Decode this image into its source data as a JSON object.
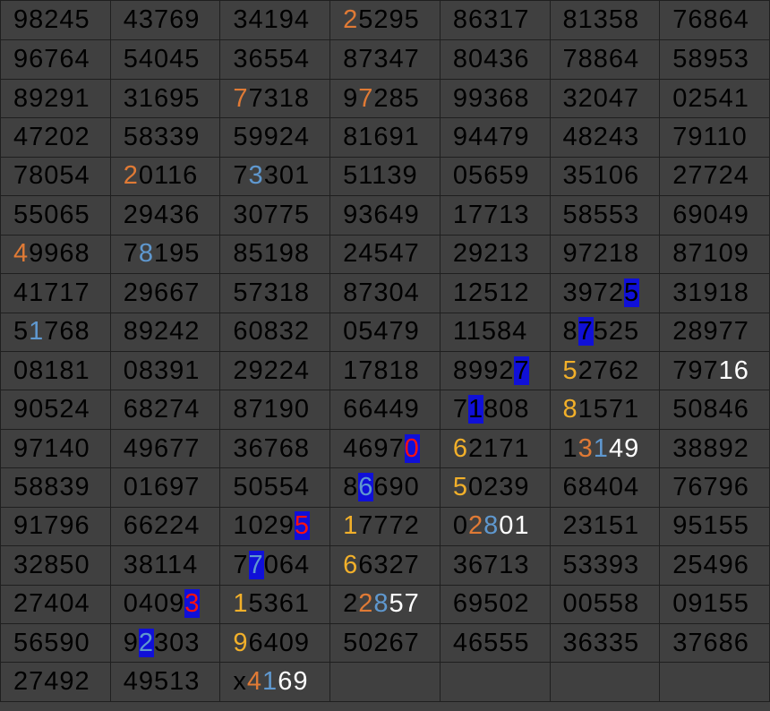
{
  "grid": {
    "rows": [
      [
        [
          [
            "2",
            "orange"
          ],
          [
            "5295",
            ""
          ]
        ],
        "98245",
        "43769",
        "34194",
        "86317",
        "81358",
        "76864"
      ],
      [
        "96764",
        "54045",
        "36554",
        "87347",
        "80436",
        "78864",
        "58953"
      ],
      [
        "89291",
        "31695",
        [
          [
            "7",
            "orange"
          ],
          [
            "7318",
            ""
          ]
        ],
        [
          [
            "9",
            ""
          ],
          [
            "7",
            "orange"
          ],
          [
            "285",
            ""
          ]
        ],
        "99368",
        "32047",
        "02541"
      ],
      [
        "47202",
        "58339",
        "59924",
        "81691",
        "94479",
        "48243",
        "79110"
      ],
      [
        "78054",
        [
          [
            "2",
            "orange"
          ],
          [
            "0116",
            ""
          ]
        ],
        [
          [
            "7",
            ""
          ],
          [
            "3",
            "lightblue"
          ],
          [
            "301",
            ""
          ]
        ],
        "51139",
        "05659",
        "35106",
        "27724"
      ],
      [
        "55065",
        "29436",
        "30775",
        "93649",
        "17713",
        "58553",
        "69049"
      ],
      [
        [
          [
            "4",
            "orange"
          ],
          [
            "9968",
            ""
          ]
        ],
        [
          [
            "7",
            ""
          ],
          [
            "8",
            "lightblue"
          ],
          [
            "195",
            ""
          ]
        ],
        "85198",
        "24547",
        "29213",
        "97218",
        "87109"
      ],
      [
        "41717",
        "29667",
        "57318",
        "87304",
        "12512",
        [
          [
            "3972",
            ""
          ],
          [
            "5",
            "bluebox"
          ]
        ],
        "31918"
      ],
      [
        [
          [
            "5",
            ""
          ],
          [
            "1",
            "lightblue"
          ],
          [
            "768",
            ""
          ]
        ],
        "89242",
        "60832",
        "05479",
        "11584",
        [
          [
            "8",
            ""
          ],
          [
            "7",
            "bluebox"
          ],
          [
            "525",
            ""
          ]
        ],
        "28977"
      ],
      [
        "08181",
        "08391",
        "29224",
        "17818",
        [
          [
            "8992",
            ""
          ],
          [
            "7",
            "bluebox"
          ]
        ],
        [
          [
            "5",
            "yellow"
          ],
          [
            "2762",
            ""
          ]
        ],
        [
          [
            "797",
            ""
          ],
          [
            "16",
            "white"
          ]
        ]
      ],
      [
        "90524",
        "68274",
        "87190",
        "66449",
        [
          [
            "7",
            ""
          ],
          [
            "1",
            "bluebox"
          ],
          [
            "808",
            ""
          ]
        ],
        [
          [
            "8",
            "yellow"
          ],
          [
            "1571",
            ""
          ]
        ],
        "50846"
      ],
      [
        "97140",
        "49677",
        "36768",
        [
          [
            "4697",
            ""
          ],
          [
            "0",
            "red"
          ]
        ],
        [
          [
            "6",
            "yellow"
          ],
          [
            "2171",
            ""
          ]
        ],
        [
          [
            "1",
            ""
          ],
          [
            "3",
            "orange"
          ],
          [
            "1",
            "lightblue"
          ],
          [
            "49",
            "white"
          ]
        ],
        "38892"
      ],
      [
        "58839",
        "01697",
        "50554",
        [
          [
            "8",
            ""
          ],
          [
            "6",
            "lightbluebox"
          ],
          [
            "690",
            ""
          ]
        ],
        [
          [
            "5",
            "yellow"
          ],
          [
            "0239",
            ""
          ]
        ],
        "68404",
        "76796"
      ],
      [
        "91796",
        "66224",
        [
          [
            "1029",
            ""
          ],
          [
            "5",
            "red"
          ]
        ],
        [
          [
            "1",
            "yellow"
          ],
          [
            "7772",
            ""
          ]
        ],
        [
          [
            "0",
            ""
          ],
          [
            "2",
            "orange"
          ],
          [
            "8",
            "lightblue"
          ],
          [
            "01",
            "white"
          ]
        ],
        "23151",
        "95155"
      ],
      [
        "32850",
        "38114",
        [
          [
            "7",
            ""
          ],
          [
            "7",
            "lightbluebox"
          ],
          [
            "064",
            ""
          ]
        ],
        [
          [
            "6",
            "yellow"
          ],
          [
            "6327",
            ""
          ]
        ],
        "36713",
        "53393",
        "25496"
      ],
      [
        "27404",
        [
          [
            "0409",
            ""
          ],
          [
            "3",
            "red"
          ]
        ],
        [
          [
            "1",
            "yellow"
          ],
          [
            "5361",
            ""
          ]
        ],
        [
          [
            "2",
            ""
          ],
          [
            "2",
            "orange"
          ],
          [
            "8",
            "lightblue"
          ],
          [
            "57",
            "white"
          ]
        ],
        "69502",
        "00558",
        "09155"
      ],
      [
        "56590",
        [
          [
            "9",
            ""
          ],
          [
            "2",
            "lightbluebox"
          ],
          [
            "303",
            ""
          ]
        ],
        [
          [
            "9",
            "yellow"
          ],
          [
            "6409",
            ""
          ]
        ],
        "50267",
        "46555",
        "36335",
        "37686"
      ],
      [
        "27492",
        "49513",
        [
          [
            "x",
            ""
          ],
          [
            "4",
            "orange"
          ],
          [
            "1",
            "lightblue"
          ],
          [
            "69",
            "white"
          ]
        ],
        "",
        "",
        "",
        ""
      ]
    ]
  }
}
